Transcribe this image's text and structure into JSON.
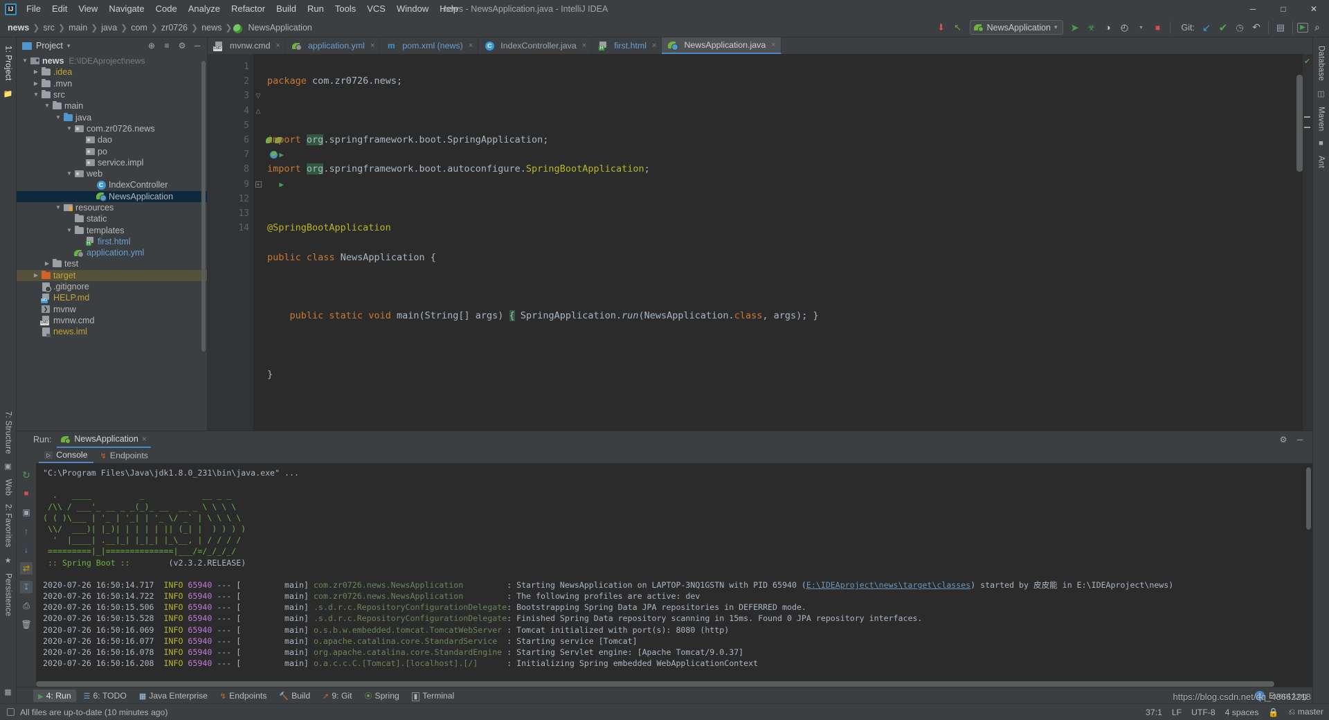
{
  "window": {
    "title": "news - NewsApplication.java - IntelliJ IDEA",
    "logo": "ij-logo",
    "minimize": "─",
    "maximize": "□",
    "close": "✕"
  },
  "menubar": {
    "items": [
      "File",
      "Edit",
      "View",
      "Navigate",
      "Code",
      "Analyze",
      "Refactor",
      "Build",
      "Run",
      "Tools",
      "VCS",
      "Window",
      "Help"
    ]
  },
  "breadcrumbs": {
    "items": [
      "news",
      "src",
      "main",
      "java",
      "com",
      "zr0726",
      "news",
      "NewsApplication"
    ],
    "separator": "❯"
  },
  "toolbar": {
    "download_icon": "⬇",
    "arrow_icon": "↖",
    "run_config": "NewsApplication",
    "dropdown_icon": "▾",
    "run_icon": "➤",
    "debug_icon": "☢",
    "coverage_icon": "◑",
    "profile_icon": "◴",
    "stop_icon": "■",
    "git_label": "Git:",
    "git_update_icon": "↙",
    "git_commit_icon": "✔",
    "git_history_icon": "◷",
    "git_rollback_icon": "↶",
    "structure_icon": "▤",
    "terminal_icon": "▶",
    "search_icon": "⌕"
  },
  "left_rail": {
    "items": [
      "1: Project",
      "7: Structure",
      "Web",
      "2: Favorites",
      "Persistence"
    ],
    "folder_icon": "folder-icon",
    "camera_icon": "camera-icon",
    "down_icon": "down-arrow-icon",
    "star_icon": "star-icon"
  },
  "right_rail": {
    "items": [
      "Database",
      "Maven",
      "Ant"
    ]
  },
  "project_panel": {
    "title": "Project",
    "dropdown_icon": "▾",
    "locate_icon": "⊕",
    "collapse_icon": "≡",
    "settings_icon": "⚙",
    "hide_icon": "─",
    "tree": [
      {
        "label": "news",
        "sub": "E:\\IDEAproject\\news",
        "depth": 0,
        "arrow": "down",
        "icon": "module",
        "style": "bold"
      },
      {
        "label": ".idea",
        "depth": 1,
        "arrow": "right",
        "icon": "folder",
        "style": "yellowish"
      },
      {
        "label": ".mvn",
        "depth": 1,
        "arrow": "right",
        "icon": "folder"
      },
      {
        "label": "src",
        "depth": 1,
        "arrow": "down",
        "icon": "folder"
      },
      {
        "label": "main",
        "depth": 2,
        "arrow": "down",
        "icon": "folder"
      },
      {
        "label": "java",
        "depth": 3,
        "arrow": "down",
        "icon": "source-folder"
      },
      {
        "label": "com.zr0726.news",
        "depth": 4,
        "arrow": "down",
        "icon": "package"
      },
      {
        "label": "dao",
        "depth": 5,
        "arrow": "none",
        "icon": "package"
      },
      {
        "label": "po",
        "depth": 5,
        "arrow": "none",
        "icon": "package"
      },
      {
        "label": "service.impl",
        "depth": 5,
        "arrow": "none",
        "icon": "package"
      },
      {
        "label": "web",
        "depth": 4,
        "arrow": "down",
        "icon": "package"
      },
      {
        "label": "IndexController",
        "depth": 6,
        "arrow": "none",
        "icon": "class"
      },
      {
        "label": "NewsApplication",
        "depth": 6,
        "arrow": "none",
        "icon": "springboot-class",
        "selected": true
      },
      {
        "label": "resources",
        "depth": 3,
        "arrow": "down",
        "icon": "resource-folder"
      },
      {
        "label": "static",
        "depth": 4,
        "arrow": "none",
        "icon": "folder"
      },
      {
        "label": "templates",
        "depth": 4,
        "arrow": "down",
        "icon": "folder"
      },
      {
        "label": "first.html",
        "depth": 5,
        "arrow": "none",
        "icon": "html",
        "style": "link"
      },
      {
        "label": "application.yml",
        "depth": 4,
        "arrow": "none",
        "icon": "yml",
        "style": "link"
      },
      {
        "label": "test",
        "depth": 2,
        "arrow": "right",
        "icon": "folder"
      },
      {
        "label": "target",
        "depth": 1,
        "arrow": "right",
        "icon": "target-folder",
        "style": "target"
      },
      {
        "label": ".gitignore",
        "depth": 1,
        "arrow": "none",
        "icon": "gitignore"
      },
      {
        "label": "HELP.md",
        "depth": 1,
        "arrow": "none",
        "icon": "md",
        "style": "yellowish"
      },
      {
        "label": "mvnw",
        "depth": 1,
        "arrow": "none",
        "icon": "sh"
      },
      {
        "label": "mvnw.cmd",
        "depth": 1,
        "arrow": "none",
        "icon": "cmd"
      },
      {
        "label": "news.iml",
        "depth": 1,
        "arrow": "none",
        "icon": "iml",
        "style": "yellowish"
      }
    ]
  },
  "editor": {
    "tabs": [
      {
        "label": "mvnw.cmd",
        "icon": "cmd",
        "active": false
      },
      {
        "label": "application.yml",
        "icon": "yml",
        "active": false
      },
      {
        "label": "pom.xml (news)",
        "icon": "maven",
        "active": false
      },
      {
        "label": "IndexController.java",
        "icon": "class",
        "active": false
      },
      {
        "label": "first.html",
        "icon": "html",
        "active": false
      },
      {
        "label": "NewsApplication.java",
        "icon": "springboot-class",
        "active": true
      }
    ],
    "close_icon": "×",
    "line_numbers": [
      "1",
      "2",
      "3",
      "4",
      "5",
      "6",
      "7",
      "8",
      "9",
      "12",
      "13",
      "14"
    ],
    "code_lines": [
      "package com.zr0726.news;",
      "",
      "import org.springframework.boot.SpringApplication;",
      "import org.springframework.boot.autoconfigure.SpringBootApplication;",
      "",
      "@SpringBootApplication",
      "public class NewsApplication {",
      "",
      "    public static void main(String[] args) { SpringApplication.run(NewsApplication.class, args); }",
      "",
      "}",
      ""
    ],
    "inspection_ok_icon": "✔"
  },
  "run_panel": {
    "label": "Run:",
    "config_name": "NewsApplication",
    "close_icon": "×",
    "settings_icon": "⚙",
    "hide_icon": "─",
    "tabs": [
      {
        "label": "Console",
        "icon": "console-icon",
        "active": true
      },
      {
        "label": "Endpoints",
        "icon": "endpoints-icon",
        "active": false
      }
    ],
    "side_buttons": [
      "rerun-icon",
      "stop-icon",
      "up-icon",
      "down-icon",
      "camera-icon",
      "wrap-icon",
      "soft-wrap-icon",
      "scroll-icon",
      "print-icon",
      "trash-icon"
    ],
    "console": {
      "command": "\"C:\\Program Files\\Java\\jdk1.8.0_231\\bin\\java.exe\" ...",
      "banner": [
        "  .   ____          _            __ _ _",
        " /\\\\ / ___'_ __ _ _(_)_ __  __ _ \\ \\ \\ \\",
        "( ( )\\___ | '_ | '_| | '_ \\/ _` | \\ \\ \\ \\",
        " \\\\/  ___)| |_)| | | | | || (_| |  ) ) ) )",
        "  '  |____| .__|_| |_|_| |_\\__, | / / / /",
        " =========|_|==============|___/=/_/_/_/"
      ],
      "spring_label": " :: Spring Boot :: ",
      "spring_version": "(v2.3.2.RELEASE)",
      "log_lines": [
        {
          "ts": "2020-07-26 16:50:14.717",
          "level": "INFO",
          "pid": "65940",
          "thread": "main",
          "logger": "com.zr0726.news.NewsApplication",
          "msg": "Starting NewsApplication on LAPTOP-3NQ1GSTN with PID 65940 (",
          "link": "E:\\IDEAproject\\news\\target\\classes",
          "msg2": ") started by 皮皮能 in E:\\IDEAproject\\news)"
        },
        {
          "ts": "2020-07-26 16:50:14.722",
          "level": "INFO",
          "pid": "65940",
          "thread": "main",
          "logger": "com.zr0726.news.NewsApplication",
          "msg": "The following profiles are active: dev"
        },
        {
          "ts": "2020-07-26 16:50:15.506",
          "level": "INFO",
          "pid": "65940",
          "thread": "main",
          "logger": ".s.d.r.c.RepositoryConfigurationDelegate",
          "msg": "Bootstrapping Spring Data JPA repositories in DEFERRED mode."
        },
        {
          "ts": "2020-07-26 16:50:15.528",
          "level": "INFO",
          "pid": "65940",
          "thread": "main",
          "logger": ".s.d.r.c.RepositoryConfigurationDelegate",
          "msg": "Finished Spring Data repository scanning in 15ms. Found 0 JPA repository interfaces."
        },
        {
          "ts": "2020-07-26 16:50:16.069",
          "level": "INFO",
          "pid": "65940",
          "thread": "main",
          "logger": "o.s.b.w.embedded.tomcat.TomcatWebServer",
          "msg": "Tomcat initialized with port(s): 8080 (http)"
        },
        {
          "ts": "2020-07-26 16:50:16.077",
          "level": "INFO",
          "pid": "65940",
          "thread": "main",
          "logger": "o.apache.catalina.core.StandardService",
          "msg": "Starting service [Tomcat]"
        },
        {
          "ts": "2020-07-26 16:50:16.078",
          "level": "INFO",
          "pid": "65940",
          "thread": "main",
          "logger": "org.apache.catalina.core.StandardEngine",
          "msg": "Starting Servlet engine: [Apache Tomcat/9.0.37]"
        },
        {
          "ts": "2020-07-26 16:50:16.208",
          "level": "INFO",
          "pid": "65940",
          "thread": "main",
          "logger": "o.a.c.c.C.[Tomcat].[localhost].[/]",
          "msg": "Initializing Spring embedded WebApplicationContext"
        }
      ]
    }
  },
  "bottom_stripe": {
    "items": [
      {
        "label": "4: Run",
        "icon": "run-icon",
        "active": true
      },
      {
        "label": "6: TODO",
        "icon": "todo-icon",
        "active": false
      },
      {
        "label": "Java Enterprise",
        "icon": "java-ee-icon",
        "active": false
      },
      {
        "label": "Endpoints",
        "icon": "endpoints-icon",
        "active": false
      },
      {
        "label": "Build",
        "icon": "build-icon",
        "active": false
      },
      {
        "label": "9: Git",
        "icon": "git-icon",
        "active": false
      },
      {
        "label": "Spring",
        "icon": "spring-icon",
        "active": false
      },
      {
        "label": "Terminal",
        "icon": "terminal-icon",
        "active": false
      }
    ],
    "event_log": "Event Log",
    "event_badge": "1"
  },
  "statusbar": {
    "message": "All files are up-to-date (10 minutes ago)",
    "caret": "37:1",
    "line_sep": "LF",
    "encoding": "UTF-8",
    "indent": "4 spaces",
    "branch": "master",
    "lock_icon": "🔒",
    "branch_icon": "⎇"
  },
  "watermark": "https://blog.csdn.net/qq_43662218"
}
